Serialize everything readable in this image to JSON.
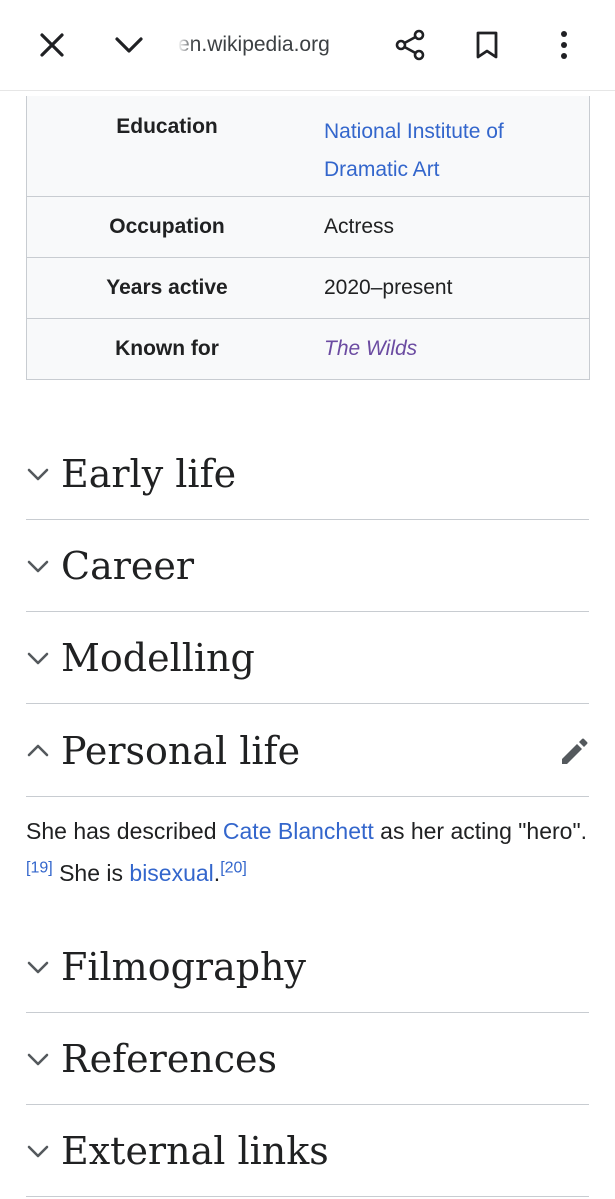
{
  "toolbar": {
    "url": "en.wikipedia.org"
  },
  "icons": {
    "close": "close-icon",
    "collapse": "chevron-down-icon",
    "share": "share-icon",
    "bookmark": "bookmark-icon",
    "more": "more-vert-icon",
    "edit": "pencil-icon"
  },
  "infobox": {
    "rows": [
      {
        "label": "Education",
        "value_line1": "National Institute of",
        "value_line2": "Dramatic Art"
      },
      {
        "label": "Occupation",
        "value": "Actress"
      },
      {
        "label": "Years active",
        "value": "2020–present"
      },
      {
        "label": "Known for",
        "value": "The Wilds"
      }
    ]
  },
  "sections": [
    {
      "title": "Early life",
      "expanded": false
    },
    {
      "title": "Career",
      "expanded": false
    },
    {
      "title": "Modelling",
      "expanded": false
    },
    {
      "title": "Personal life",
      "expanded": true
    },
    {
      "title": "Filmography",
      "expanded": false
    },
    {
      "title": "References",
      "expanded": false
    },
    {
      "title": "External links",
      "expanded": false
    }
  ],
  "personal_life": {
    "text1": "She has described ",
    "link1": "Cate Blanchett",
    "text2": " as her acting \"hero\".",
    "ref1": "[19]",
    "text3": " She is ",
    "link2": "bisexual",
    "text4": ".",
    "ref2": "[20]"
  },
  "colors": {
    "link": "#3366cc",
    "visited_link": "#6b4ba1",
    "text": "#202122",
    "border": "#c8ccd1",
    "infobox_bg": "#f8f9fa"
  }
}
